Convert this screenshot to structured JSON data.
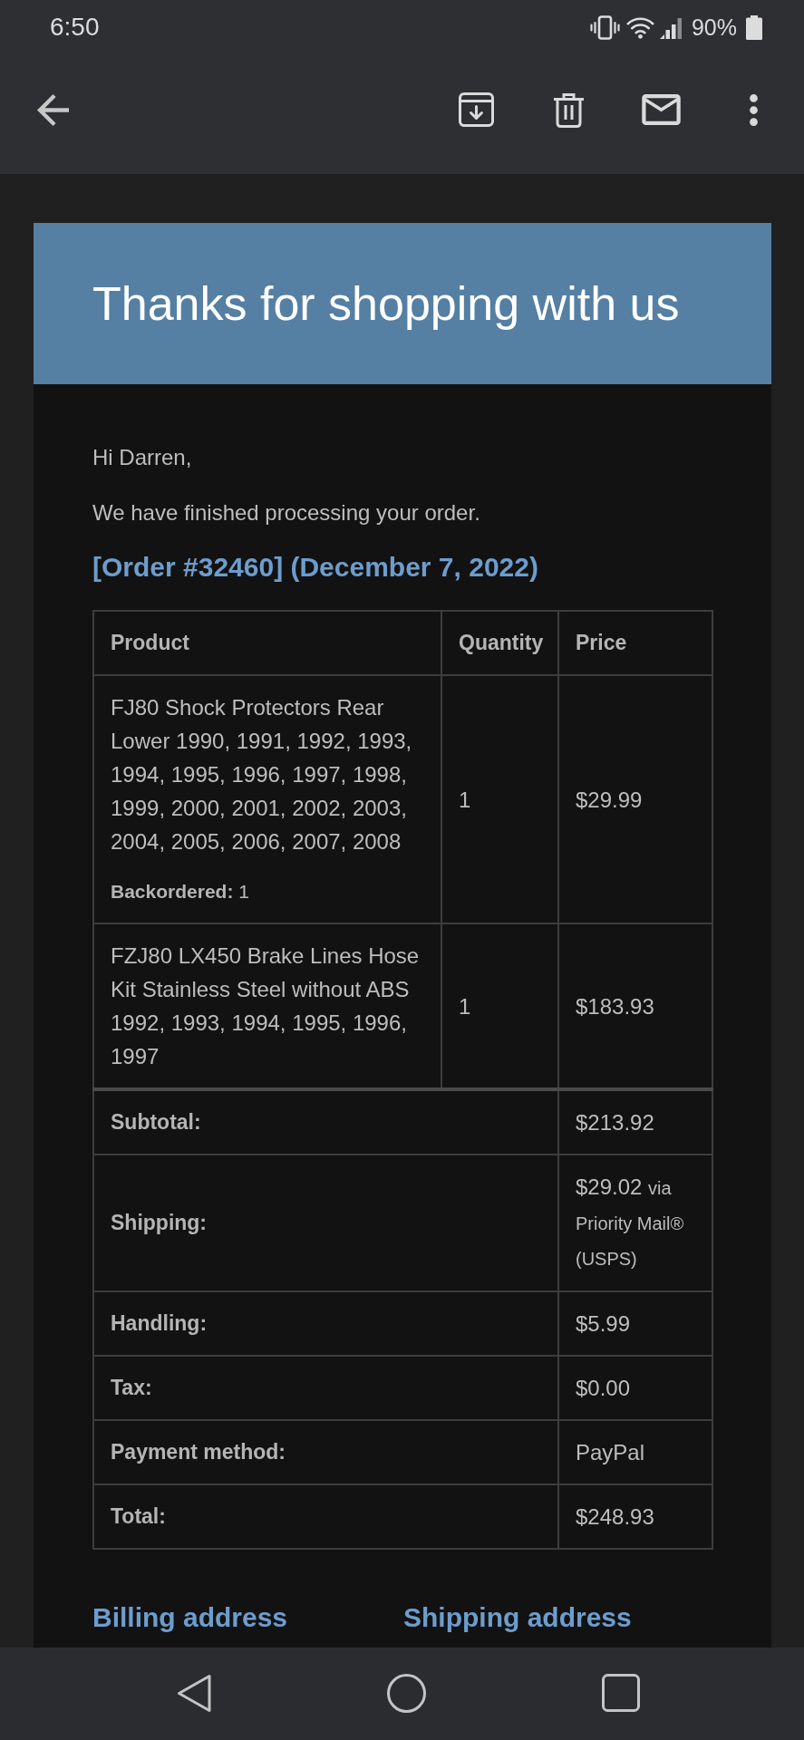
{
  "status_bar": {
    "time": "6:50",
    "battery": "90%"
  },
  "email": {
    "banner_title": "Thanks for shopping with us",
    "greeting": "Hi Darren,",
    "intro": "We have finished processing your order.",
    "order_heading": "[Order #32460] (December 7, 2022)",
    "table": {
      "columns": [
        "Product",
        "Quantity",
        "Price"
      ],
      "items": [
        {
          "product": "FJ80 Shock Protectors Rear Lower 1990, 1991, 1992, 1993, 1994, 1995, 1996, 1997, 1998, 1999, 2000, 2001, 2002, 2003, 2004, 2005, 2006, 2007, 2008",
          "note": "**Backordered:** 1",
          "quantity": "1",
          "price": "$29.99"
        },
        {
          "product": "FZJ80 LX450 Brake Lines Hose Kit Stainless Steel without ABS 1992, 1993, 1994, 1995, 1996, 1997",
          "quantity": "1",
          "price": "$183.93"
        }
      ],
      "totals": [
        {
          "label": "Subtotal:",
          "value": "$213.92"
        },
        {
          "label": "Shipping:",
          "value": "$29.02",
          "note": "via Priority Mail® (USPS)"
        },
        {
          "label": "Handling:",
          "value": "$5.99"
        },
        {
          "label": "Tax:",
          "value": "$0.00"
        },
        {
          "label": "Payment method:",
          "value": "PayPal"
        },
        {
          "label": "Total:",
          "value": "$248.93"
        }
      ]
    },
    "address_headings": [
      "Billing address",
      "Shipping address"
    ]
  }
}
